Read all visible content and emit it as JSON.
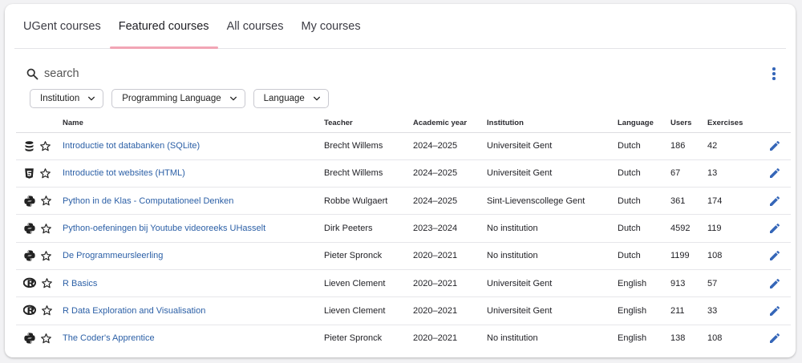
{
  "tabs": [
    "UGent courses",
    "Featured courses",
    "All courses",
    "My courses"
  ],
  "active_tab": "Featured courses",
  "search": {
    "placeholder": "search"
  },
  "filters": [
    "Institution",
    "Programming Language",
    "Language"
  ],
  "columns": [
    "Name",
    "Teacher",
    "Academic year",
    "Institution",
    "Language",
    "Users",
    "Exercises"
  ],
  "colors": {
    "link": "#2b5fa6",
    "accent": "#3566b8",
    "tab_indicator": "#f2a5b5"
  },
  "rows": [
    {
      "icon": "database-icon",
      "name": "Introductie tot databanken (SQLite)",
      "teacher": "Brecht Willems",
      "year": "2024–2025",
      "institution": "Universiteit Gent",
      "language": "Dutch",
      "users": "186",
      "exercises": "42"
    },
    {
      "icon": "html5-icon",
      "name": "Introductie tot websites (HTML)",
      "teacher": "Brecht Willems",
      "year": "2024–2025",
      "institution": "Universiteit Gent",
      "language": "Dutch",
      "users": "67",
      "exercises": "13"
    },
    {
      "icon": "python-icon",
      "name": "Python in de Klas - Computationeel Denken",
      "teacher": "Robbe Wulgaert",
      "year": "2024–2025",
      "institution": "Sint-Lievenscollege Gent",
      "language": "Dutch",
      "users": "361",
      "exercises": "174"
    },
    {
      "icon": "python-icon",
      "name": "Python-oefeningen bij Youtube videoreeks UHasselt",
      "teacher": "Dirk Peeters",
      "year": "2023–2024",
      "institution": "No institution",
      "language": "Dutch",
      "users": "4592",
      "exercises": "119"
    },
    {
      "icon": "python-icon",
      "name": "De Programmeursleerling",
      "teacher": "Pieter Spronck",
      "year": "2020–2021",
      "institution": "No institution",
      "language": "Dutch",
      "users": "1199",
      "exercises": "108"
    },
    {
      "icon": "r-icon",
      "name": "R Basics",
      "teacher": "Lieven Clement",
      "year": "2020–2021",
      "institution": "Universiteit Gent",
      "language": "English",
      "users": "913",
      "exercises": "57"
    },
    {
      "icon": "r-icon",
      "name": "R Data Exploration and Visualisation",
      "teacher": "Lieven Clement",
      "year": "2020–2021",
      "institution": "Universiteit Gent",
      "language": "English",
      "users": "211",
      "exercises": "33"
    },
    {
      "icon": "python-icon",
      "name": "The Coder's Apprentice",
      "teacher": "Pieter Spronck",
      "year": "2020–2021",
      "institution": "No institution",
      "language": "English",
      "users": "138",
      "exercises": "108"
    }
  ]
}
